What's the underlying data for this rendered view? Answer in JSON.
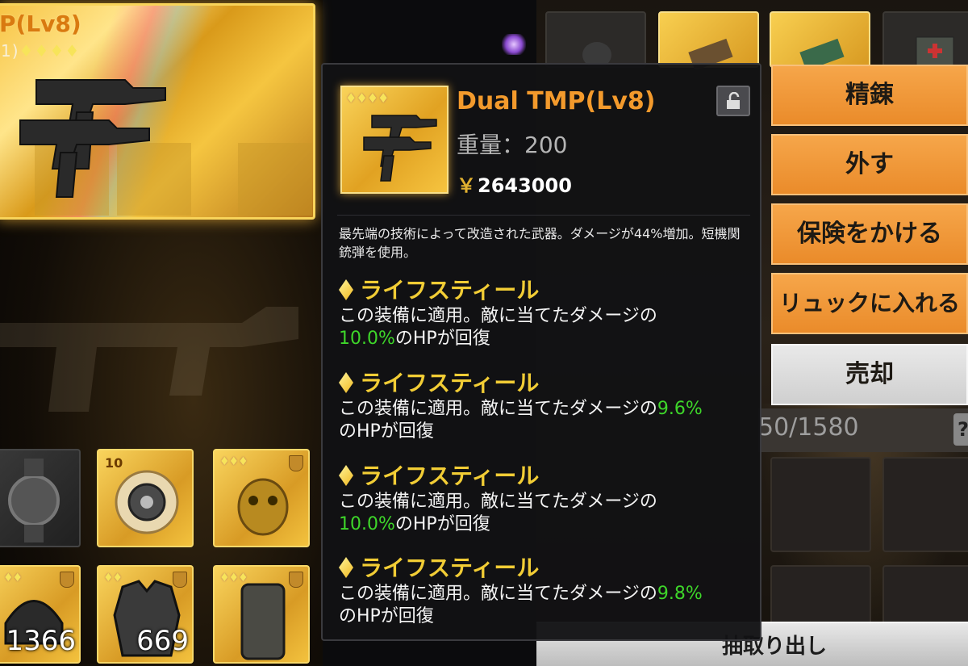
{
  "feature": {
    "title": "P(Lv8)",
    "subtitle": "1)",
    "stars": "♦♦♦♦"
  },
  "inventory": {
    "slots": [
      {
        "count": "",
        "stars": ""
      },
      {
        "count": "",
        "stars": "",
        "level": "10"
      },
      {
        "count": "",
        "stars": "♦♦♦"
      },
      {
        "count": "1366",
        "stars": "♦♦"
      },
      {
        "count": "669",
        "stars": "♦♦"
      },
      {
        "count": "",
        "stars": "♦♦♦"
      }
    ]
  },
  "tooltip": {
    "stars": "♦♦♦♦",
    "name": "Dual TMP(Lv8)",
    "weight": "重量：200",
    "price_symbol": "￥",
    "price": "2643000",
    "description": "最先端の技術によって改造された武器。ダメージが44%増加。短機関銃弾を使用。",
    "perks": [
      {
        "title": "ライフスティール",
        "text_before": "この装備に適用。敵に当てたダメージの",
        "value": "10.0%",
        "text_after": "のHPが回復",
        "value_newline": true
      },
      {
        "title": "ライフスティール",
        "text_before": "この装備に適用。敵に当てたダメージの",
        "value": "9.6%",
        "text_after": "のHPが回復",
        "value_newline": false
      },
      {
        "title": "ライフスティール",
        "text_before": "この装備に適用。敵に当てたダメージの",
        "value": "10.0%",
        "text_after": "のHPが回復",
        "value_newline": true
      },
      {
        "title": "ライフスティール",
        "text_before": "この装備に適用。敵に当てたダメージの",
        "value": "9.8%",
        "text_after": "のHPが回復",
        "value_newline": false
      }
    ]
  },
  "actions": {
    "refine": "精錬",
    "remove": "外す",
    "insure": "保険をかける",
    "to_backpack": "リュックに入れる",
    "sell": "売却"
  },
  "capacity": {
    "text": "50/1580",
    "help": "?"
  },
  "bottom_bar": {
    "label": "抽取り出し"
  },
  "colors": {
    "accent_orange": "#f39a2c",
    "perk_gold": "#f2cd35",
    "value_green": "#3ed62a"
  }
}
